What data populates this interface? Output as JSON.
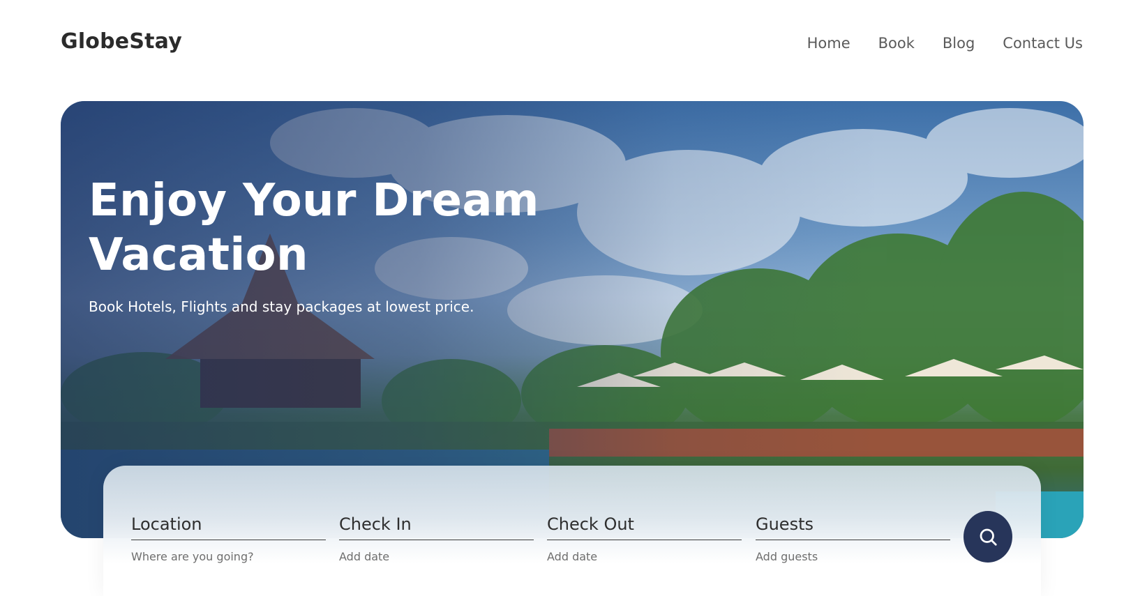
{
  "brand": {
    "name": "GlobeStay"
  },
  "nav": {
    "items": [
      {
        "label": "Home"
      },
      {
        "label": "Book"
      },
      {
        "label": "Blog"
      },
      {
        "label": "Contact Us"
      }
    ]
  },
  "hero": {
    "title": "Enjoy Your Dream Vacation",
    "subtitle": "Book Hotels, Flights and stay packages at lowest price."
  },
  "search": {
    "fields": [
      {
        "label": "Location",
        "placeholder": "Where are you going?"
      },
      {
        "label": "Check In",
        "placeholder": "Add date"
      },
      {
        "label": "Check Out",
        "placeholder": "Add date"
      },
      {
        "label": "Guests",
        "placeholder": "Add guests"
      }
    ],
    "button_icon": "search-icon"
  },
  "colors": {
    "accent": "#27355a",
    "text": "#2b2b2b",
    "muted": "#6e6e6e"
  }
}
